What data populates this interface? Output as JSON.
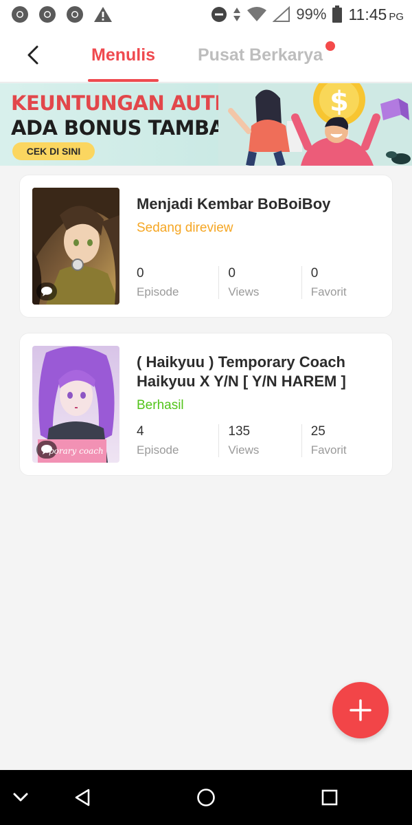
{
  "status_bar": {
    "icons": [
      "chrome-icon",
      "chrome-icon",
      "chrome-icon",
      "warning-icon",
      "do-not-disturb-icon",
      "data-arrows-icon",
      "wifi-icon",
      "signal-icon",
      "battery-icon"
    ],
    "battery": "99%",
    "time": "11:45",
    "ampm": "PG"
  },
  "header": {
    "tabs": [
      {
        "label": "Menulis",
        "active": true
      },
      {
        "label": "Pusat Berkarya",
        "active": false,
        "has_notification_dot": true
      }
    ]
  },
  "banner": {
    "line1": "KEUNTUNGAN AUTHOR",
    "line2": "ADA BONUS TAMBAHAN!",
    "cta": "CEK DI SINI"
  },
  "works": [
    {
      "title": "Menjadi Kembar BoBoiBoy",
      "status": "Sedang direview",
      "status_color": "#f5a623",
      "stats": [
        {
          "value": "0",
          "label": "Episode"
        },
        {
          "value": "0",
          "label": "Views"
        },
        {
          "value": "0",
          "label": "Favorit"
        }
      ]
    },
    {
      "title": "( Haikyuu ) Temporary Coach Haikyuu X Y/N [ Y/N HAREM ]",
      "status": "Berhasil",
      "status_color": "#52c41a",
      "cover_caption": "porary coach",
      "stats": [
        {
          "value": "4",
          "label": "Episode"
        },
        {
          "value": "135",
          "label": "Views"
        },
        {
          "value": "25",
          "label": "Favorit"
        }
      ]
    }
  ],
  "colors": {
    "accent": "#ef4a4f",
    "inactive_tab": "#bdbdbd",
    "background": "#f4f4f4"
  },
  "fab": {
    "icon": "plus-icon"
  },
  "nav_bar": {
    "buttons": [
      "chevron-down-icon",
      "back-triangle-icon",
      "home-circle-icon",
      "recents-square-icon"
    ]
  }
}
